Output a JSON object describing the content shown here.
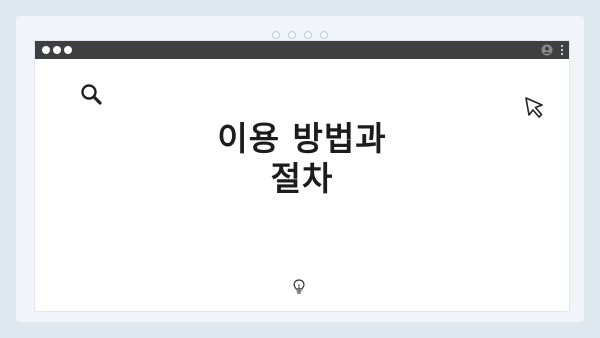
{
  "frame": {
    "dots": 4
  },
  "window": {
    "titlebar": {
      "controls": [
        "dot",
        "dot",
        "dot"
      ],
      "right_icons": [
        "user-icon",
        "kebab-icon"
      ]
    },
    "icons": [
      "search-icon",
      "cursor-icon",
      "bulb-icon"
    ],
    "title": {
      "line1": "이용 방법과",
      "line2": "절차"
    }
  },
  "colors": {
    "background": "#dfe7ef",
    "titlebar": "#3f3f3f",
    "window": "#ffffff",
    "text": "#1c1c1c"
  }
}
